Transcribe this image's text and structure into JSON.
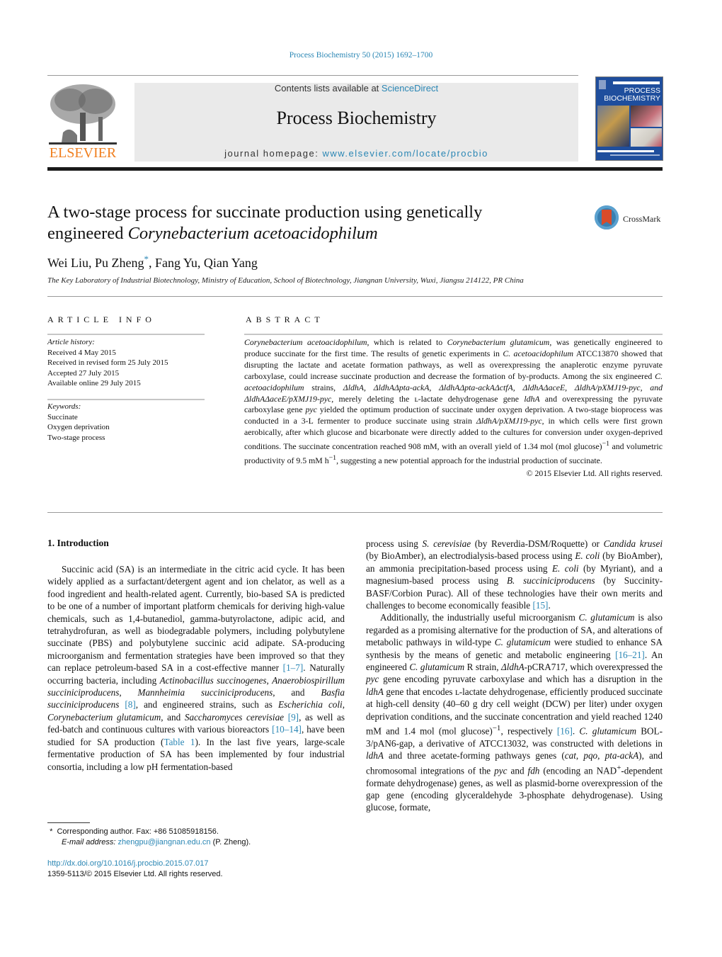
{
  "header": {
    "citation": "Process Biochemistry 50 (2015) 1692–1700",
    "publisher_logo_text": "ELSEVIER",
    "contents_prefix": "Contents lists available at ",
    "contents_link": "ScienceDirect",
    "journal_title": "Process Biochemistry",
    "homepage_prefix": "journal homepage: ",
    "homepage_link": "www.elsevier.com/locate/procbio",
    "cover_title_line1": "PROCESS",
    "cover_title_line2": "BIOCHEMISTRY",
    "colors": {
      "link": "#2a86b4",
      "elsevier_orange": "#f07f1f",
      "cover_blue": "#1f4e9d",
      "masthead_gray": "#eaeaea"
    }
  },
  "article": {
    "title_line1": "A two-stage process for succinate production using genetically",
    "title_line2_plain": "engineered ",
    "title_line2_italic": "Corynebacterium acetoacidophilum",
    "crossmark_label": "CrossMark",
    "authors": {
      "a1": "Wei Liu, Pu Zheng",
      "star": "*",
      "a2": ", Fang Yu, Qian Yang"
    },
    "affiliation": "The Key Laboratory of Industrial Biotechnology, Ministry of Education, School of Biotechnology, Jiangnan University, Wuxi, Jiangsu 214122, PR China"
  },
  "article_info": {
    "heading": "ARTICLE INFO",
    "history_label": "Article history:",
    "history": [
      "Received 4 May 2015",
      "Received in revised form 25 July 2015",
      "Accepted 27 July 2015",
      "Available online 29 July 2015"
    ],
    "keywords_label": "Keywords:",
    "keywords": [
      "Succinate",
      "Oxygen deprivation",
      "Two-stage process"
    ]
  },
  "abstract": {
    "heading": "ABSTRACT",
    "s1_i": "Corynebacterium acetoacidophilum",
    "s1_a": ", which is related to ",
    "s1_i2": "Corynebacterium glutamicum",
    "s1_b": ", was genetically engineered to produce succinate for the first time. The results of genetic experiments in ",
    "s1_i3": "C. acetoacidophilum",
    "s1_c": " ATCC13870 showed that disrupting the lactate and acetate formation pathways, as well as overexpressing the anaplerotic enzyme pyruvate carboxylase, could increase succinate production and decrease the formation of by-products. Among the six engineered ",
    "s1_i4": "C. acetoacidophilum",
    "s1_d": " strains, ",
    "strains": "ΔldhA, ΔldhAΔpta-ackA, ΔldhAΔpta-ackAΔctfA, ΔldhAΔaceE, ΔldhA/pXMJ19-pyc, and ΔldhAΔaceE/pXMJ19-pyc",
    "s1_e": ", merely deleting the ʟ-lactate dehydrogenase gene ",
    "gene1": "ldhA",
    "s1_f": " and overexpressing the pyruvate carboxylase gene ",
    "gene2": "pyc",
    "s1_g": " yielded the optimum production of succinate under oxygen deprivation. A two-stage bioprocess was conducted in a 3-L fermenter to produce succinate using strain ",
    "strain2": "ΔldhA/pXMJ19-pyc",
    "s1_h": ", in which cells were first grown aerobically, after which glucose and bicarbonate were directly added to the cultures for conversion under oxygen-deprived conditions. The succinate concentration reached 908 mM, with an overall yield of 1.34 mol (mol glucose)",
    "sup1": "−1",
    "s1_j": " and volumetric productivity of 9.5 mM h",
    "sup2": "−1",
    "s1_k": ", suggesting a new potential approach for the industrial production of succinate.",
    "copyright": "© 2015 Elsevier Ltd. All rights reserved."
  },
  "body": {
    "section_heading": "1.  Introduction",
    "left": {
      "p1_a": "Succinic acid (SA) is an intermediate in the citric acid cycle. It has been widely applied as a surfactant/detergent agent and ion chelator, as well as a food ingredient and health-related agent. Currently, bio-based SA is predicted to be one of a number of important platform chemicals for deriving high-value chemicals, such as 1,4-butanediol, gamma-butyrolactone, adipic acid, and tetrahydrofuran, as well as biodegradable polymers, including polybutylene succinate (PBS) and polybutylene succinic acid adipate. SA-producing microorganism and fermentation strategies have been improved so that they can replace petroleum-based SA in a cost-effective manner ",
      "ref1": "[1–7]",
      "p1_b": ". Naturally occurring bacteria, including ",
      "sp1": "Actinobacillus succinogenes",
      "sp2": "Anaerobiospirillum succiniciproducens",
      "sp3": "Mannheimia succiniciproducens",
      "p1_c": ", and ",
      "sp4": "Basfia succiniciproducens",
      "ref2": "[8]",
      "p1_d": ", and engineered strains, such as ",
      "sp5": "Escherichia coli",
      "sp6": "Corynebacterium glutamicum",
      "sp7": "Saccharomyces cerevisiae",
      "ref3": "[9]",
      "p1_e": ", as well as fed-batch and continuous cultures with various bioreactors ",
      "ref4": "[10–14]",
      "p1_f": ", have been studied for SA production (",
      "ref5": "Table 1",
      "p1_g": "). In the last five years, large-scale fermentative production of SA has been implemented by four industrial consortia, including a low pH fermentation-based"
    },
    "right": {
      "p1_a": "process using ",
      "sp1": "S. cerevisiae",
      "p1_b": " (by Reverdia-DSM/Roquette) or ",
      "sp2": "Candida krusei",
      "p1_c": " (by BioAmber), an electrodialysis-based process using ",
      "sp3": "E. coli",
      "p1_d": " (by BioAmber), an ammonia precipitation-based process using ",
      "sp4": "E. coli",
      "p1_e": " (by Myriant), and a magnesium-based process using ",
      "sp5": "B. succiniciproducens",
      "p1_f": " (by Succinity-BASF/Corbion Purac). All of these technologies have their own merits and challenges to become economically feasible ",
      "ref1": "[15]",
      "p1_g": ".",
      "p2_a": "Additionally, the industrially useful microorganism ",
      "sp6": "C. glutamicum",
      "p2_b": " is also regarded as a promising alternative for the production of SA, and alterations of metabolic pathways in wild-type ",
      "sp7": "C. glutamicum",
      "p2_c": " were studied to enhance SA synthesis by the means of genetic and metabolic engineering ",
      "ref2": "[16–21]",
      "p2_d": ". An engineered ",
      "sp8": "C. glutamicum",
      "p2_e": " R strain, ",
      "strain1": "ΔldhA",
      "p2_f": "-pCRA717, which overexpressed the ",
      "gene1": "pyc",
      "p2_g": " gene encoding pyruvate carboxylase and which has a disruption in the ",
      "gene2": "ldhA",
      "p2_h": " gene that encodes ʟ-lactate dehydrogenase, efficiently produced succinate at high-cell density (40–60 g dry cell weight (DCW) per liter) under oxygen deprivation conditions, and the succinate concentration and yield reached 1240 mM and 1.4 mol (mol glucose)",
      "sup1": "−1",
      "p2_i": ", respectively ",
      "ref3": "[16]",
      "p2_j": ". ",
      "sp9": "C. glutamicum",
      "p2_k": " BOL-3/pAN6-gap, a derivative of ATCC13032, was constructed with deletions in ",
      "gene3": "ldhA",
      "p2_l": " and three acetate-forming pathways genes (",
      "gene4": "cat",
      "gene5": "pqo",
      "gene6": "pta-ackA",
      "p2_m": "), and chromosomal integrations of the ",
      "gene7": "pyc",
      "p2_n": " and ",
      "gene8": "fdh",
      "p2_o": " (encoding an NAD",
      "sup2": "+",
      "p2_p": "-dependent formate dehydrogenase) genes, as well as plasmid-borne overexpression of the gap gene (encoding glyceraldehyde 3-phosphate dehydrogenase). Using glucose, formate,"
    }
  },
  "footnotes": {
    "star": "*",
    "corresponding": "Corresponding author. Fax: +86 51085918156.",
    "email_label": "E-mail address: ",
    "email": "zhengpu@jiangnan.edu.cn",
    "email_suffix": " (P. Zheng).",
    "doi": "http://dx.doi.org/10.1016/j.procbio.2015.07.017",
    "issn": "1359-5113/© 2015 Elsevier Ltd. All rights reserved."
  }
}
